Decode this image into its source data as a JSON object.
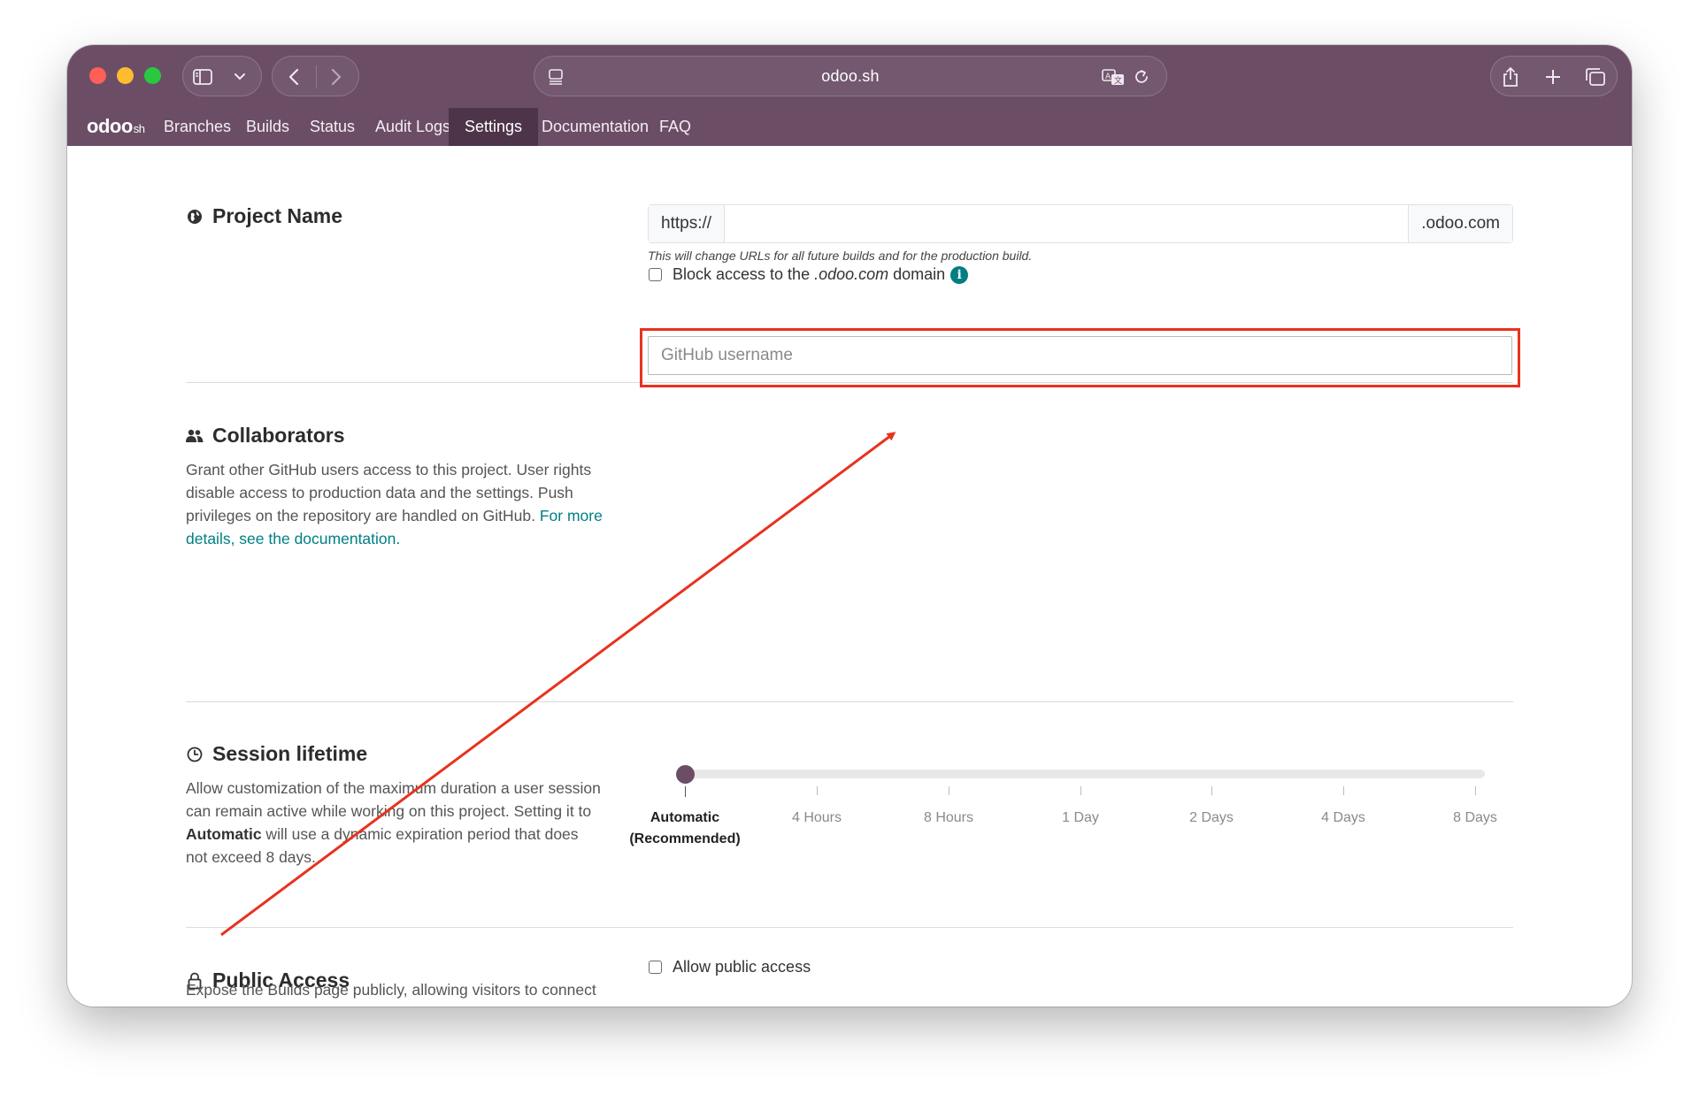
{
  "browser": {
    "address": "odoo.sh"
  },
  "appnav": {
    "logo_main": "odoo",
    "logo_sub": "sh",
    "items": [
      {
        "label": "Branches",
        "active": false
      },
      {
        "label": "Builds",
        "active": false
      },
      {
        "label": "Status",
        "active": false
      },
      {
        "label": "Audit Logs",
        "active": false
      },
      {
        "label": "Settings",
        "active": true
      },
      {
        "label": "Documentation",
        "active": false
      },
      {
        "label": "FAQ",
        "active": false
      }
    ]
  },
  "project_name": {
    "title": "Project Name",
    "prefix": "https://",
    "value": "",
    "suffix": ".odoo.com",
    "hint": "This will change URLs for all future builds and for the production build.",
    "block_access_pre": "Block access to the ",
    "block_access_domain": ".odoo.com",
    "block_access_post": " domain",
    "block_access_checked": false,
    "info_glyph": "i"
  },
  "collaborators": {
    "title": "Collaborators",
    "description": "Grant other GitHub users access to this project. User rights disable access to production data and the settings. Push privileges on the repository are handled on GitHub.",
    "link": "For more details, see the documentation.",
    "input_placeholder": "GitHub username",
    "input_value": ""
  },
  "session": {
    "title": "Session lifetime",
    "desc_1": "Allow customization of the maximum duration a user session can remain active while working on this project. Setting it to ",
    "desc_bold": "Automatic",
    "desc_2": " will use a dynamic expiration period that does not exceed 8 days.",
    "options": [
      "Automatic",
      "4 Hours",
      "8 Hours",
      "1 Day",
      "2 Days",
      "4 Days",
      "8 Days"
    ],
    "recommended_note": "(Recommended)",
    "selected_index": 0
  },
  "public_access": {
    "title": "Public Access",
    "description": "Expose the Builds page publicly, allowing visitors to connect to your development builds.",
    "checkbox_label": "Allow public access",
    "checked": false
  },
  "annotation": {
    "highlight_color": "#e8321f"
  },
  "colors": {
    "brand": "#6b4e66",
    "brand_dark": "#4d3449",
    "link": "#017e84"
  }
}
